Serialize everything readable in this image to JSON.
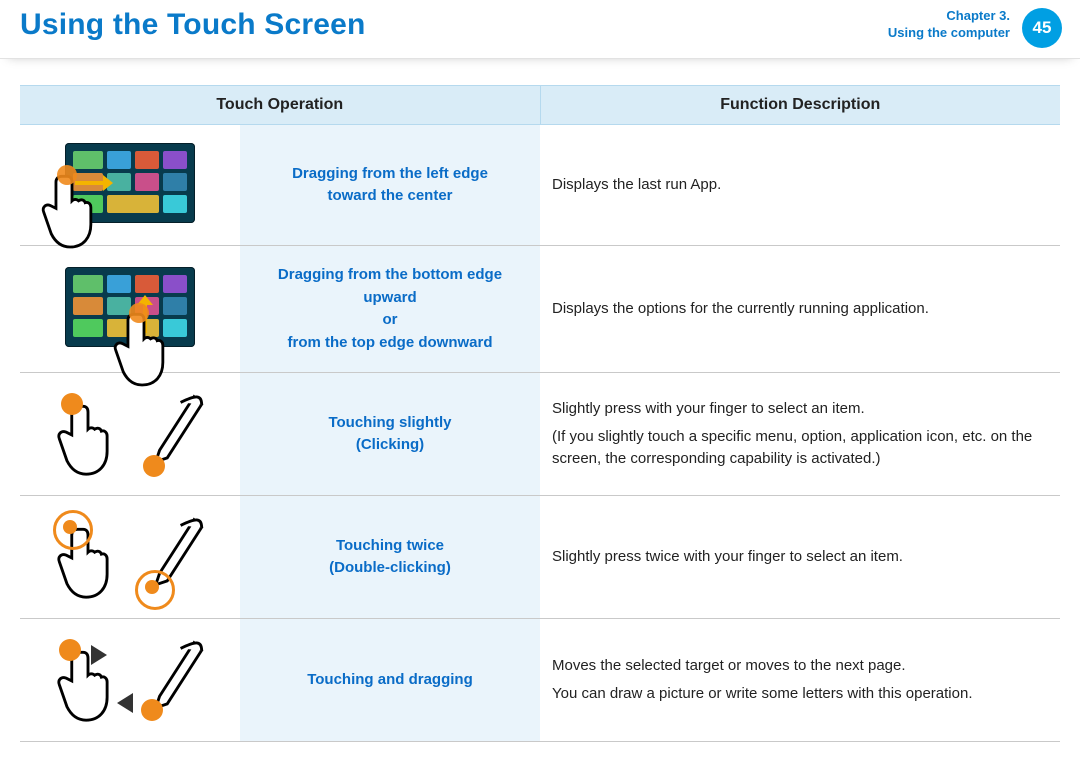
{
  "header": {
    "title": "Using the Touch Screen",
    "chapter_line1": "Chapter 3.",
    "chapter_line2": "Using the computer",
    "page_number": "45"
  },
  "table": {
    "col_operation": "Touch Operation",
    "col_description": "Function Description",
    "rows": [
      {
        "operation_lines": [
          "Dragging from the left edge",
          "toward the center"
        ],
        "description_paras": [
          "Displays the last run App."
        ],
        "icon": "tablet-left-swipe"
      },
      {
        "operation_lines": [
          "Dragging from the bottom edge",
          "upward",
          "or",
          "from the top edge downward"
        ],
        "description_paras": [
          "Displays the options for the currently running application."
        ],
        "icon": "tablet-bottom-swipe"
      },
      {
        "operation_lines": [
          "Touching slightly",
          "(Clicking)"
        ],
        "description_paras": [
          "Slightly press with your finger to select an item.",
          "(If you slightly touch a specific menu, option, application icon, etc. on the screen, the corresponding capability is activated.)"
        ],
        "icon": "tap-single"
      },
      {
        "operation_lines": [
          "Touching twice",
          "(Double-clicking)"
        ],
        "description_paras": [
          "Slightly press twice with your finger to select an item."
        ],
        "icon": "tap-double"
      },
      {
        "operation_lines": [
          "Touching and dragging"
        ],
        "description_paras": [
          "Moves the selected target or moves to the next page.",
          "You can draw a picture or write some letters with this operation."
        ],
        "icon": "tap-drag"
      }
    ]
  }
}
